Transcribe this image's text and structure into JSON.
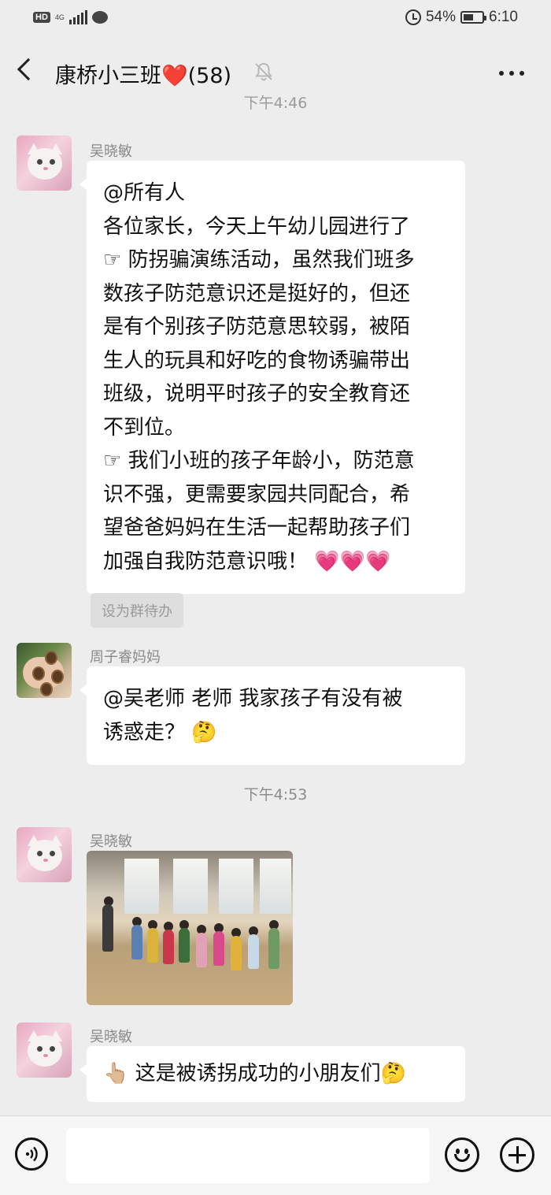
{
  "status_bar": {
    "hd": "HD",
    "network": "4G",
    "battery_percent": "54%",
    "battery_level": 0.54,
    "time": "6:10"
  },
  "nav": {
    "title": "康桥小三班❤️(58)",
    "back_icon": "chevron-left-icon",
    "mute_icon": "bell-off-icon",
    "more_icon": "more-dots-icon"
  },
  "messages": [
    {
      "sender": "吴晓敏",
      "lines": [
        "@所有人",
        "各位家长，今天上午幼儿园进行了",
        "☞ 防拐骗演练活动，虽然我们班多",
        "数孩子防范意识还是挺好的，但还",
        "是有个别孩子防范意思较弱，被陌",
        "生人的玩具和好吃的食物诱骗带出",
        "班级，说明平时孩子的安全教育还",
        "不到位。",
        "☞ 我们小班的孩子年龄小，防范意",
        "识不强，更需要家园共同配合，希",
        "望爸爸妈妈在生活一起帮助孩子们",
        "加强自我防范意识哦！ 💗💗💗"
      ],
      "action": "设为群待办"
    },
    {
      "sender": "周子睿妈妈",
      "lines": [
        "@吴老师 老师 我家孩子有没有被",
        "诱惑走？ 🤔"
      ]
    },
    {
      "time_divider": "下午4:53"
    },
    {
      "sender": "吴晓敏",
      "image": "photo-kids-in-hall"
    },
    {
      "sender": "吴晓敏",
      "lines": [
        "👆🏼 这是被诱拐成功的小朋友们🤔"
      ]
    }
  ],
  "input_bar": {
    "voice_icon": "voice-icon",
    "text_value": "",
    "emoji_icon": "emoji-icon",
    "plus_icon": "plus-icon"
  }
}
